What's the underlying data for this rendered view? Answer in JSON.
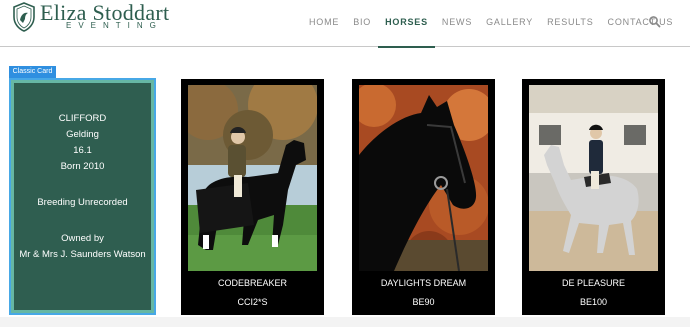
{
  "brand": {
    "title": "Eliza Stoddart",
    "subtitle": "EVENTING"
  },
  "nav": {
    "items": [
      {
        "label": "HOME"
      },
      {
        "label": "BIO"
      },
      {
        "label": "HORSES",
        "active": true
      },
      {
        "label": "NEWS"
      },
      {
        "label": "GALLERY"
      },
      {
        "label": "RESULTS"
      },
      {
        "label": "CONTACT US"
      }
    ],
    "search_icon": "search-icon"
  },
  "classic_card": {
    "tag": "Classic Card",
    "name": "CLIFFORD",
    "type": "Gelding",
    "height": "16.1",
    "born": "Born 2010",
    "breeding": "Breeding Unrecorded",
    "owned_by_label": "Owned by",
    "owner": "Mr & Mrs J. Saunders Watson"
  },
  "horses": [
    {
      "name": "CODEBREAKER",
      "level": "CCI2*S"
    },
    {
      "name": "DAYLIGHTS DREAM",
      "level": "BE90"
    },
    {
      "name": "DE PLEASURE",
      "level": "BE100"
    }
  ],
  "colors": {
    "brand_green": "#2e5e4f",
    "card_green": "#2f5e50",
    "tag_blue": "#2f8fe0"
  }
}
